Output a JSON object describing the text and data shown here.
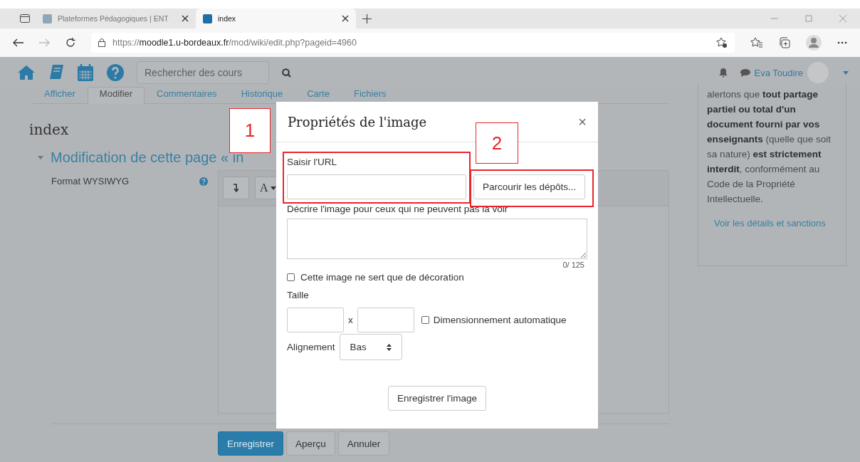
{
  "browser": {
    "tabs": [
      {
        "title": "Plateformes Pédagogiques | ENT",
        "selected": false
      },
      {
        "title": "index",
        "selected": true
      }
    ],
    "address": {
      "scheme": "https://",
      "host": "moodle1.u-bordeaux.fr",
      "path": "/mod/wiki/edit.php?pageid=4960"
    }
  },
  "navbar": {
    "search_placeholder": "Rechercher des cours",
    "user": "Eva Toudire"
  },
  "page": {
    "tabs": [
      {
        "label": "Afficher",
        "selected": false
      },
      {
        "label": "Modifier",
        "selected": true
      },
      {
        "label": "Commentaires",
        "selected": false
      },
      {
        "label": "Historique",
        "selected": false
      },
      {
        "label": "Carte",
        "selected": false
      },
      {
        "label": "Fichiers",
        "selected": false
      }
    ],
    "title": "index",
    "section": "Modification de cette page « in",
    "editor_label": "Format WYSIWYG",
    "toolbar_letter": "A",
    "buttons": [
      {
        "label": "Enregistrer",
        "kind": "primary"
      },
      {
        "label": "Aperçu",
        "kind": "secondary"
      },
      {
        "label": "Annuler",
        "kind": "secondary"
      }
    ]
  },
  "notice": {
    "text": "alertons que **tout partage partiel ou total d'un document fourni par vos enseignants** (quelle que soit sa nature) **est strictement interdit**, conformément au Code de la Propriété Intellectuelle.",
    "link": "Voir les détails et sanctions"
  },
  "modal": {
    "title": "Propriétés de l'image",
    "close": "×",
    "url_label": "Saisir l'URL",
    "browse_button": "Parcourir les dépôts...",
    "alt_label": "Décrire l'image pour ceux qui ne peuvent pas la voir",
    "counter": "0/ 125",
    "decorative": {
      "label": "Cette image ne sert que de décoration",
      "checked": false
    },
    "size_label": "Taille",
    "size_separator": "x",
    "auto_size": {
      "label": "Dimensionnement automatique",
      "checked": false
    },
    "align_label": "Alignement",
    "align_value": "Bas",
    "save_button": "Enregistrer l'image"
  },
  "annotations": [
    {
      "label": "1"
    },
    {
      "label": "2"
    }
  ]
}
